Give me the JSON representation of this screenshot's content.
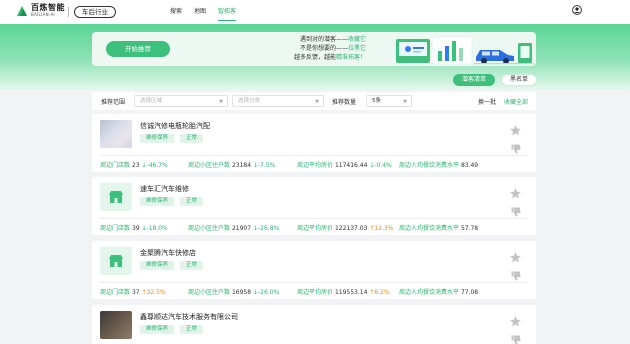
{
  "header": {
    "logo_cn": "百炼智能",
    "logo_en": "BAILIAN·AI",
    "industry_tag": "车后行业",
    "nav": [
      {
        "label": "搜索",
        "active": false
      },
      {
        "label": "地图",
        "active": false
      },
      {
        "label": "智拓客",
        "active": true
      }
    ]
  },
  "banner": {
    "start_button": "开始推荐",
    "slogan": [
      {
        "text": "遇到对的潜客——",
        "highlight": "收藏它"
      },
      {
        "text": "不是你想要的——",
        "highlight": "拉黑它"
      },
      {
        "text": "越多反馈，越能",
        "highlight": "精准拓客！"
      }
    ]
  },
  "actions": {
    "leads_list": "潜客清单",
    "blacklist": "黑名单"
  },
  "filter": {
    "range_label": "推荐范围",
    "region_placeholder": "选择区域",
    "category_placeholder": "选择分类",
    "count_label": "推荐数量",
    "count_value": "5条",
    "refresh": "换一批",
    "favorite_all": "收藏全部"
  },
  "stat_labels": {
    "stores": "周边门店数",
    "households": "周边小区住户数",
    "house_price": "周边平均房价",
    "consumption": "周边人均餐饮消费水平"
  },
  "shops": [
    {
      "name": "信诚汽修电瓶轮胎汽配",
      "tags": [
        "维修保养",
        "正常"
      ],
      "stores": "23",
      "stores_delta": "↓-46.7%",
      "stores_dir": "down",
      "households": "23184",
      "households_delta": "↓-7.5%",
      "households_dir": "down",
      "house_price": "117416.44",
      "house_price_delta": "↓-0.4%",
      "house_price_dir": "down",
      "consumption": "83.49"
    },
    {
      "name": "速车汇汽车维修",
      "tags": [
        "维修保养",
        "正常"
      ],
      "stores": "39",
      "stores_delta": "↓-18.0%",
      "stores_dir": "down",
      "households": "21907",
      "households_delta": "↓-26.8%",
      "households_dir": "down",
      "house_price": "122137.03",
      "house_price_delta": "↑12.3%",
      "house_price_dir": "up",
      "consumption": "57.78"
    },
    {
      "name": "金聚腾汽车快修店",
      "tags": [
        "维修保养",
        "正常"
      ],
      "stores": "37",
      "stores_delta": "↑32.5%",
      "stores_dir": "up",
      "households": "16958",
      "households_delta": "↓-26.0%",
      "households_dir": "down",
      "house_price": "119553.14",
      "house_price_delta": "↑6.2%",
      "house_price_dir": "up",
      "consumption": "77.08"
    },
    {
      "name": "鑫尊顺达汽车技术服务有限公司",
      "tags": [
        "维修保养",
        "正常"
      ]
    }
  ],
  "colors": {
    "brand_green": "#2ab56f",
    "button_green": "#3ec07d",
    "increase_orange": "#f08c1e"
  },
  "icons": [
    "logo-icon",
    "user-icon",
    "shop-icon",
    "star-icon",
    "thumb-down-icon"
  ]
}
